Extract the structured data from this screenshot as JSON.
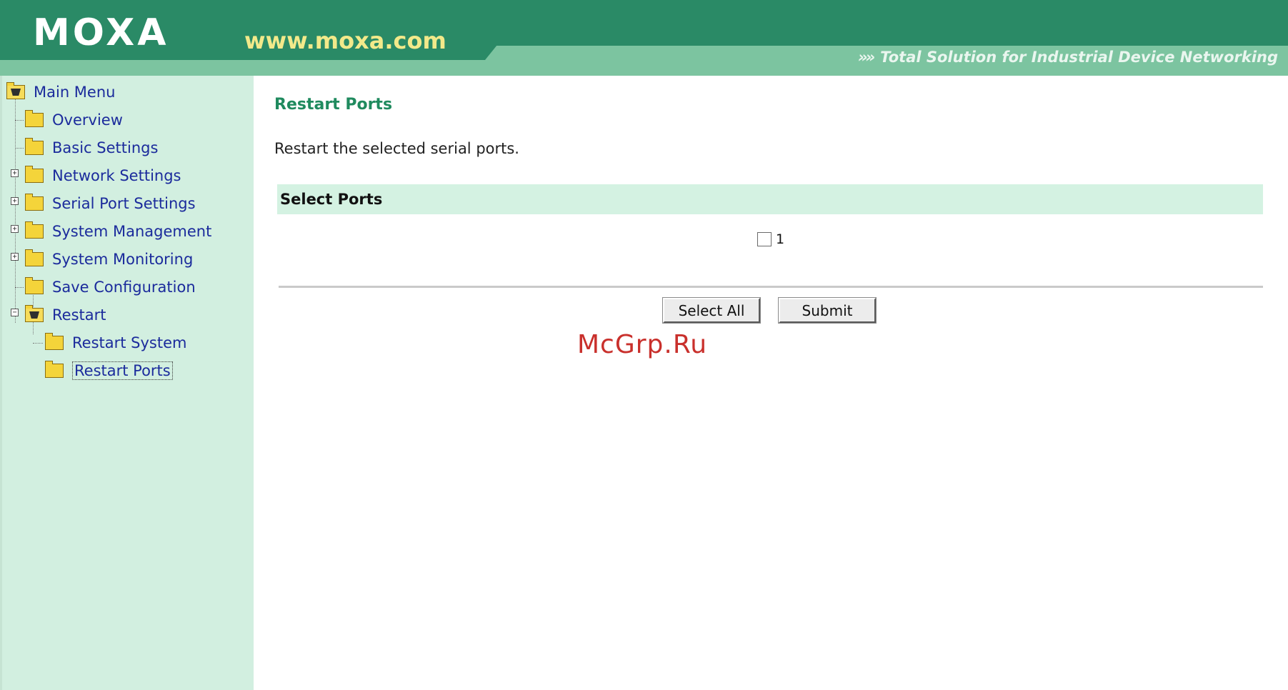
{
  "header": {
    "logo": "MOXA",
    "url": "www.moxa.com",
    "tagline_arrows": "»»",
    "tagline": "Total Solution for Industrial Device Networking"
  },
  "sidebar": {
    "root_label": "Main Menu",
    "items": [
      {
        "label": "Overview",
        "expandable": false
      },
      {
        "label": "Basic Settings",
        "expandable": false
      },
      {
        "label": "Network Settings",
        "expandable": true,
        "expanded": false
      },
      {
        "label": "Serial Port Settings",
        "expandable": true,
        "expanded": false
      },
      {
        "label": "System Management",
        "expandable": true,
        "expanded": false
      },
      {
        "label": "System Monitoring",
        "expandable": true,
        "expanded": false
      },
      {
        "label": "Save Configuration",
        "expandable": false
      },
      {
        "label": "Restart",
        "expandable": true,
        "expanded": true,
        "children": [
          {
            "label": "Restart System"
          },
          {
            "label": "Restart Ports",
            "selected": true
          }
        ]
      }
    ]
  },
  "main": {
    "title": "Restart Ports",
    "description": "Restart the selected serial ports.",
    "select_ports_header": "Select Ports",
    "ports": [
      {
        "label": "1",
        "checked": false
      }
    ],
    "buttons": {
      "select_all": "Select All",
      "submit": "Submit"
    }
  },
  "watermark": "McGrp.Ru",
  "colors": {
    "header_dark": "#2a8a66",
    "header_light": "#7cc4a0",
    "sidebar_bg": "#d2efe0",
    "link": "#1b2b9c",
    "title_green": "#1f8a5e",
    "section_bg": "#d4f2e2",
    "watermark_red": "#c9302c"
  }
}
